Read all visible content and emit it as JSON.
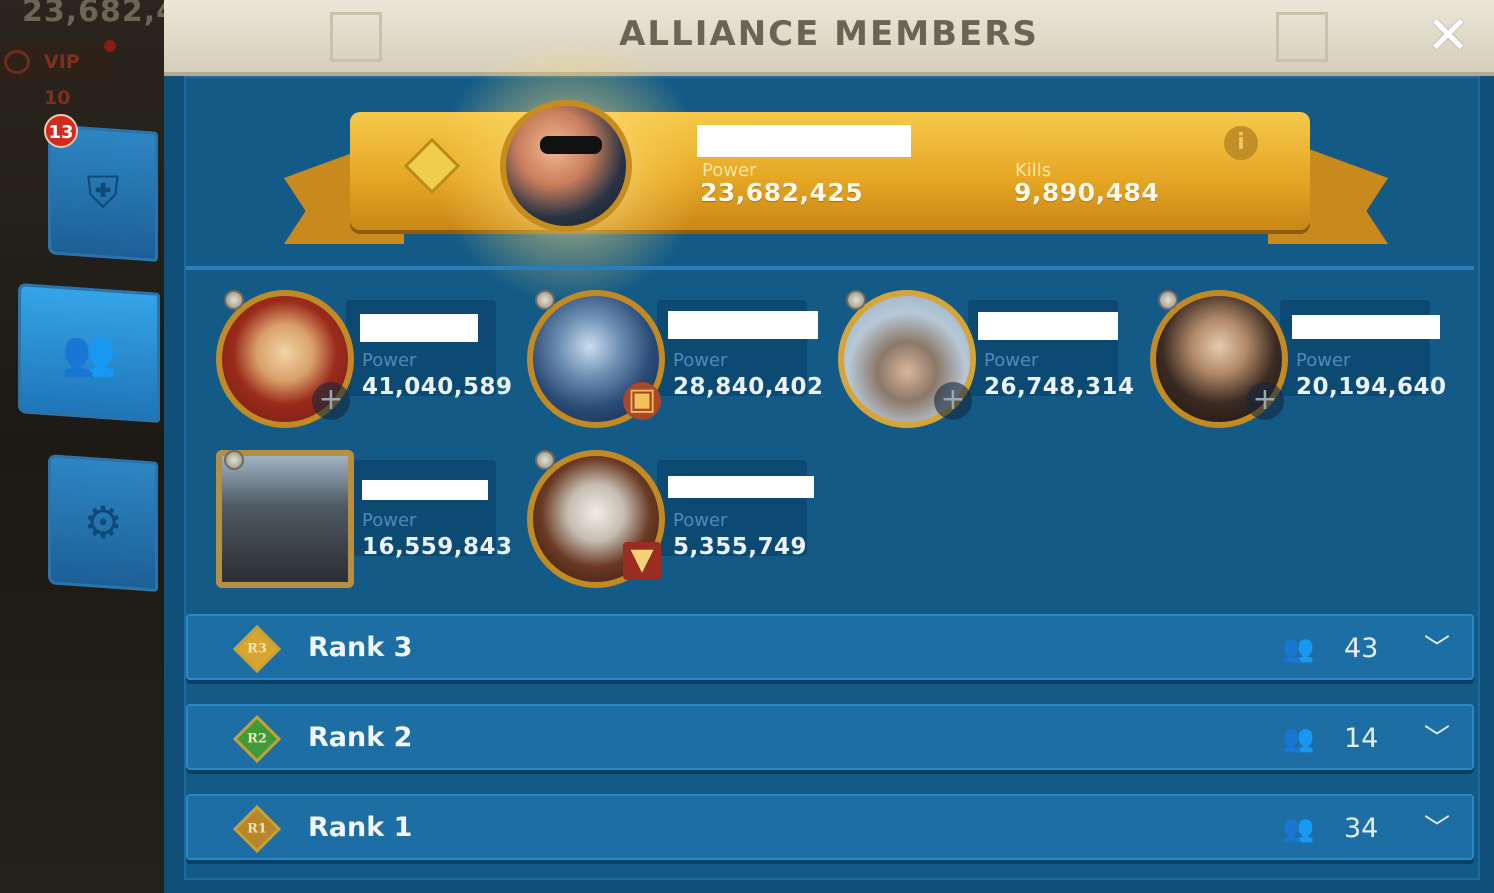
{
  "game": {
    "top_power": "23,682,4",
    "vip": "VIP 10",
    "alert_badge": "13"
  },
  "sidebar": [
    {
      "name": "alliance-shield-tab",
      "icon": "shield-icon",
      "active": false
    },
    {
      "name": "members-tab",
      "icon": "people-icon",
      "active": true
    },
    {
      "name": "settings-tab",
      "icon": "gear-icon",
      "active": false
    }
  ],
  "header": {
    "title": "ALLIANCE MEMBERS",
    "close_label": "✕"
  },
  "leader": {
    "power_label": "Power",
    "power": "23,682,425",
    "kills_label": "Kills",
    "kills": "9,890,484",
    "info_label": "i"
  },
  "members": [
    {
      "power_label": "Power",
      "power": "41,040,589"
    },
    {
      "power_label": "Power",
      "power": "28,840,402"
    },
    {
      "power_label": "Power",
      "power": "26,748,314"
    },
    {
      "power_label": "Power",
      "power": "20,194,640"
    },
    {
      "power_label": "Power",
      "power": "16,559,843"
    },
    {
      "power_label": "Power",
      "power": "5,355,749"
    }
  ],
  "ranks": [
    {
      "label": "Rank 3",
      "icon_text": "R3",
      "count": "43",
      "color": "#d7a62e"
    },
    {
      "label": "Rank 2",
      "icon_text": "R2",
      "count": "14",
      "color": "#3f9a3a"
    },
    {
      "label": "Rank 1",
      "icon_text": "R1",
      "count": "34",
      "color": "#b8862a"
    }
  ]
}
